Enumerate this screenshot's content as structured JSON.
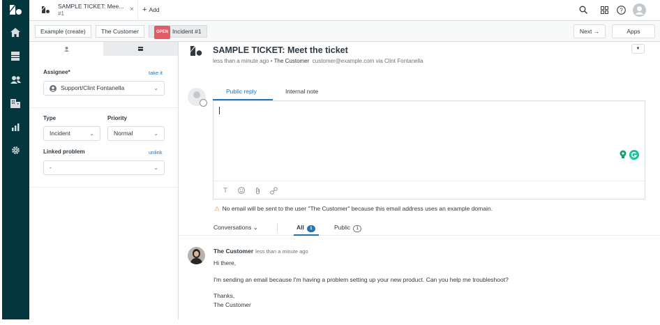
{
  "topbar": {
    "tab_title": "SAMPLE TICKET: Mee...",
    "tab_subtitle": "#1",
    "tab_close": "×",
    "add_label": "Add",
    "add_plus": "+"
  },
  "crumbs": {
    "items": [
      "Example (create)",
      "The Customer"
    ],
    "status_badge": "OPEN",
    "incident_label": "Incident #1",
    "next_label": "Next →",
    "apps_label": "Apps"
  },
  "props": {
    "assignee_label": "Assignee*",
    "take_it": "take it",
    "assignee_value": "Support/Clint Fontanella",
    "type_label": "Type",
    "type_value": "Incident",
    "priority_label": "Priority",
    "priority_value": "Normal",
    "linked_label": "Linked problem",
    "unlink": "unlink",
    "linked_value": "-"
  },
  "ticket": {
    "title": "SAMPLE TICKET: Meet the ticket",
    "meta_time": "less than a minute ago",
    "meta_sep": " • ",
    "meta_user": "The Customer",
    "meta_email": "customer@example.com via Clint Fontanella"
  },
  "reply": {
    "tab_public": "Public reply",
    "tab_internal": "Internal note",
    "warning": "No email will be sent to the user \"The Customer\" because this email address uses an example domain."
  },
  "conversation": {
    "filter_label": "Conversations ⌄",
    "all_label": "All",
    "all_count": "1",
    "public_label": "Public",
    "public_count": "1"
  },
  "comment": {
    "author": "The Customer",
    "time": "less than a minute ago",
    "greeting": "Hi there,",
    "body": "I'm sending an email because I'm having a problem setting up your new product. Can you help me troubleshoot?",
    "signoff": "Thanks,",
    "signature": "The Customer"
  },
  "colors": {
    "nav_bg": "#03363d",
    "accent": "#1f73b7",
    "open_badge": "#e35b66",
    "warning": "#ed961c"
  }
}
